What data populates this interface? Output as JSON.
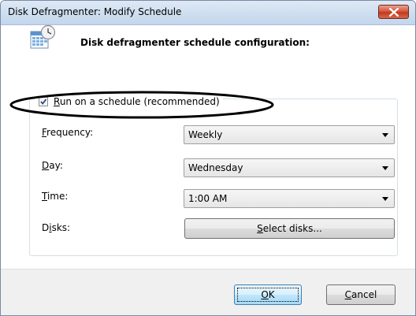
{
  "window": {
    "title": "Disk Defragmenter: Modify Schedule"
  },
  "header": {
    "text": "Disk defragmenter schedule configuration:"
  },
  "schedule": {
    "checkbox_label": "Run on a schedule (recommended)",
    "checked": true
  },
  "fields": {
    "frequency": {
      "label": "Frequency:",
      "value": "Weekly"
    },
    "day": {
      "label": "Day:",
      "value": "Wednesday"
    },
    "time": {
      "label": "Time:",
      "value": "1:00 AM"
    },
    "disks": {
      "label": "Disks:",
      "button": "Select disks..."
    }
  },
  "buttons": {
    "ok": "OK",
    "cancel": "Cancel"
  },
  "colors": {
    "close_button": "#c23a1e",
    "annotation": "#000000"
  },
  "icons": {
    "header": "calendar-clock-icon",
    "close": "close-icon",
    "dropdown": "chevron-down-icon"
  }
}
